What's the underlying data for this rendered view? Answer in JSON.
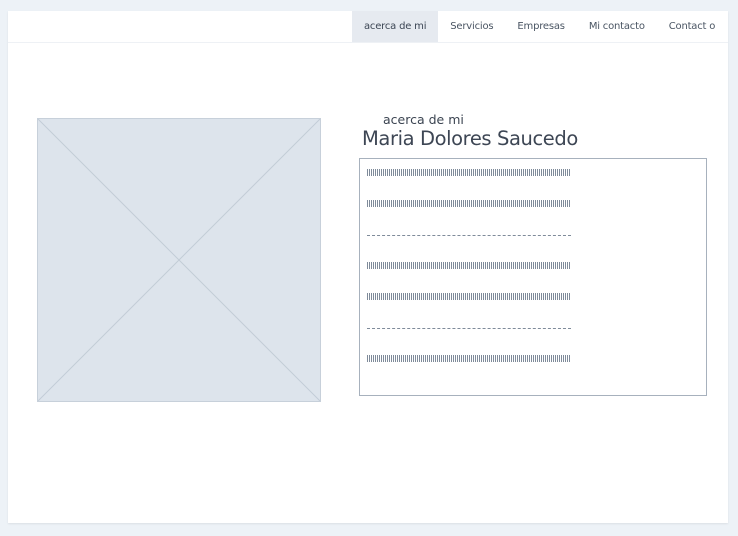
{
  "nav": {
    "items": [
      {
        "label": "acerca de mi",
        "active": true
      },
      {
        "label": "Servicios",
        "active": false
      },
      {
        "label": "Empresas",
        "active": false
      },
      {
        "label": "Mi contacto",
        "active": false
      },
      {
        "label": "Contact o",
        "active": false
      }
    ],
    "search_icon": "search-icon"
  },
  "hero": {
    "subtitle": "acerca de mi",
    "title": "Maria Dolores Saucedo",
    "image_icon": "image-placeholder-icon"
  },
  "text_block": {
    "line_styles": [
      "dense",
      "dense",
      "sparse",
      "dense",
      "dense",
      "sparse",
      "dense"
    ]
  },
  "colors": {
    "background": "#edf2f7",
    "active_nav": "#e6eaf0",
    "placeholder_fill": "#dde4ec",
    "text": "#3d4654"
  }
}
